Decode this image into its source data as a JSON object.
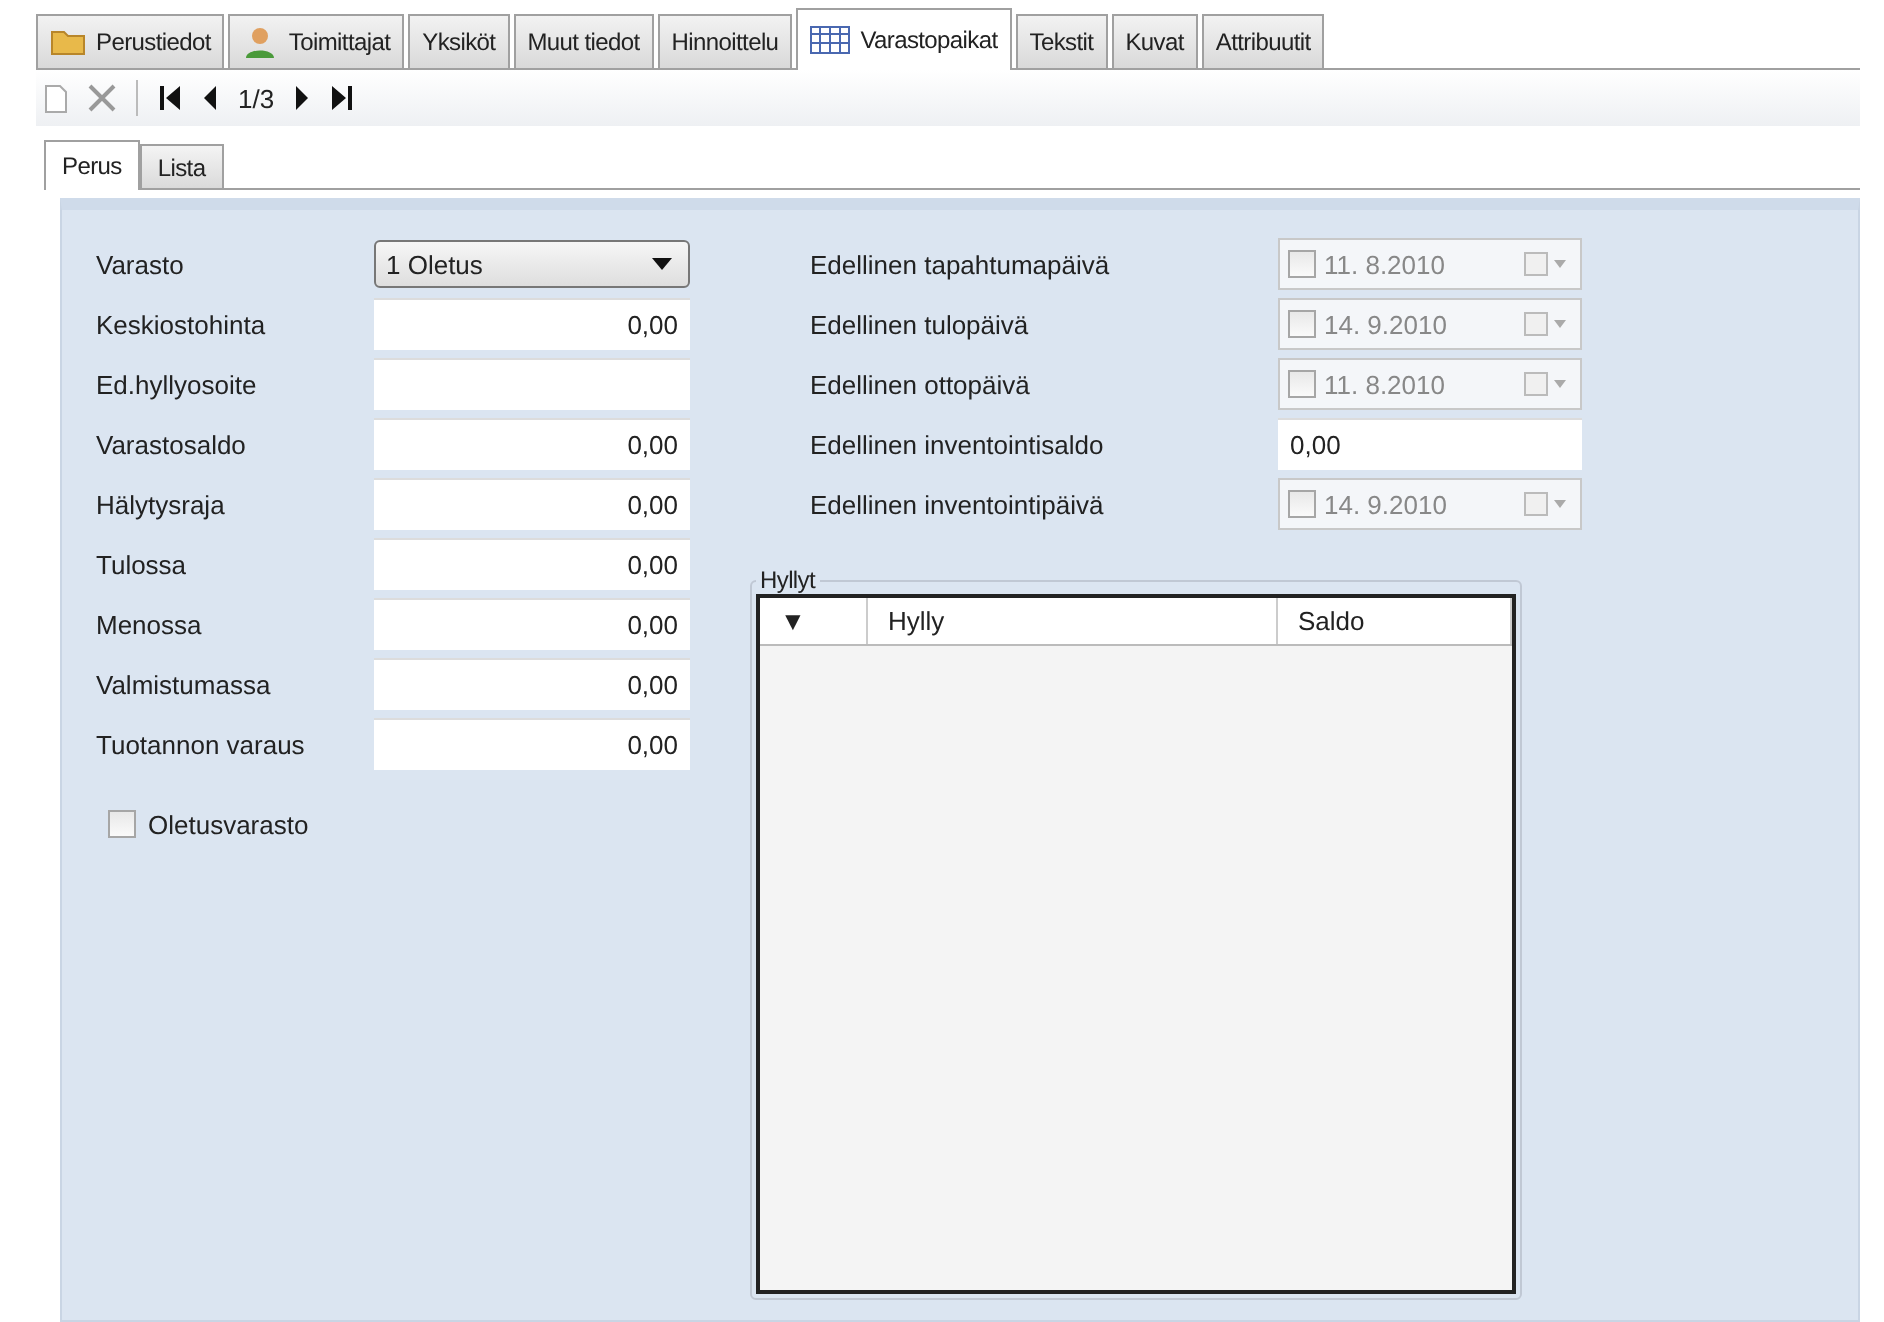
{
  "tabs": [
    {
      "label": "Perustiedot",
      "kind": "folder",
      "selected": false
    },
    {
      "label": "Toimittajat",
      "kind": "person",
      "selected": false
    },
    {
      "label": "Yksiköt",
      "kind": "plain",
      "selected": false
    },
    {
      "label": "Muut tiedot",
      "kind": "plain",
      "selected": false
    },
    {
      "label": "Hinnoittelu",
      "kind": "plain",
      "selected": false
    },
    {
      "label": "Varastopaikat",
      "kind": "table",
      "selected": true
    },
    {
      "label": "Tekstit",
      "kind": "plain",
      "selected": false
    },
    {
      "label": "Kuvat",
      "kind": "plain",
      "selected": false
    },
    {
      "label": "Attribuutit",
      "kind": "plain",
      "selected": false
    }
  ],
  "toolbar": {
    "record": "1/3"
  },
  "subtabs": [
    {
      "label": "Perus",
      "selected": true
    },
    {
      "label": "Lista",
      "selected": false
    }
  ],
  "left_fields": [
    {
      "label": "Varasto",
      "kind": "dropdown",
      "value": "1 Oletus"
    },
    {
      "label": "Keskiostohinta",
      "kind": "number",
      "value": "0,00"
    },
    {
      "label": "Ed.hyllyosoite",
      "kind": "text"
    },
    {
      "label": "Varastosaldo",
      "kind": "number",
      "value": "0,00"
    },
    {
      "label": "Hälytysraja",
      "kind": "number",
      "value": "0,00"
    },
    {
      "label": "Tulossa",
      "kind": "number",
      "value": "0,00"
    },
    {
      "label": "Menossa",
      "kind": "number",
      "value": "0,00"
    },
    {
      "label": "Valmistumassa",
      "kind": "number",
      "value": "0,00"
    },
    {
      "label": "Tuotannon varaus",
      "kind": "number",
      "value": "0,00"
    }
  ],
  "default_checkbox": {
    "label": "Oletusvarasto",
    "checked": false
  },
  "right_fields": [
    {
      "label": "Edellinen tapahtumapäivä",
      "kind": "date",
      "value": "11. 8.2010",
      "checked": false,
      "disabled": true
    },
    {
      "label": "Edellinen tulopäivä",
      "kind": "date",
      "value": "14. 9.2010",
      "checked": false,
      "disabled": true
    },
    {
      "label": "Edellinen ottopäivä",
      "kind": "date",
      "value": "11. 8.2010",
      "checked": false,
      "disabled": true
    },
    {
      "label": "Edellinen inventointisaldo",
      "kind": "text",
      "value": "0,00"
    },
    {
      "label": "Edellinen inventointipäivä",
      "kind": "date",
      "value": "14. 9.2010",
      "checked": false,
      "disabled": true
    }
  ],
  "shelves": {
    "title": "Hyllyt",
    "filter_glyph": "▼",
    "columns": [
      "Hylly",
      "Saldo"
    ]
  }
}
